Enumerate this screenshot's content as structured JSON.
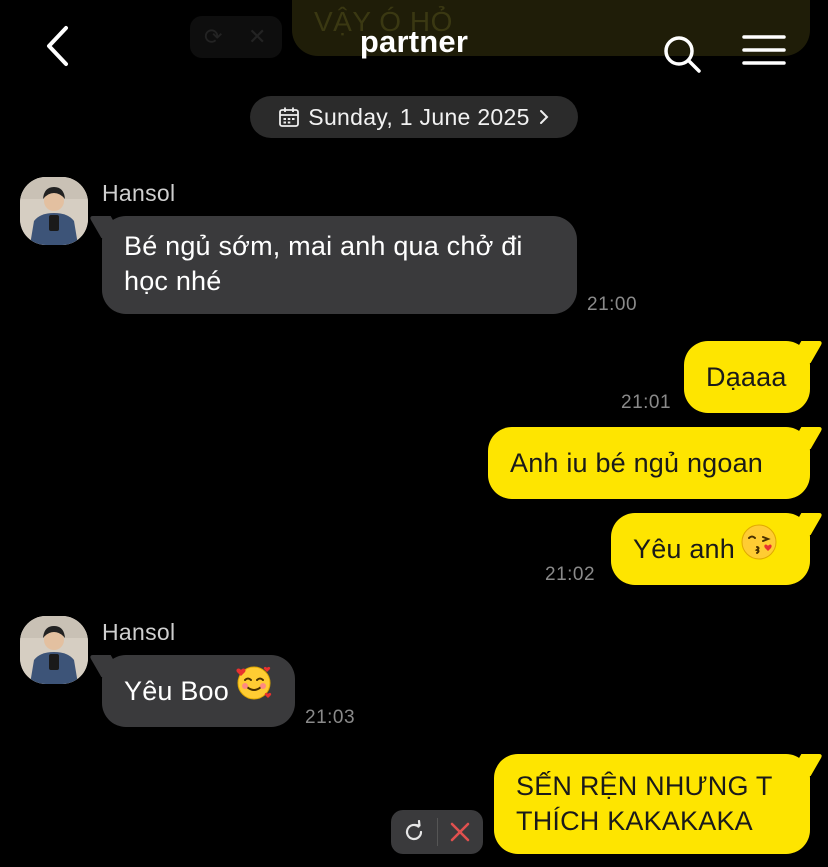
{
  "header": {
    "title": "partner",
    "back_icon": "chevron-left-icon",
    "search_icon": "search-icon",
    "menu_icon": "hamburger-menu-icon"
  },
  "background_preview": {
    "text": "VẬY Ó HỎ"
  },
  "date_divider": {
    "label": "Sunday, 1 June 2025",
    "icon": "calendar-icon"
  },
  "messages": [
    {
      "id": "m1",
      "direction": "incoming",
      "sender": "Hansol",
      "text": "Bé ngủ sớm, mai anh qua chở đi học nhé",
      "time": "21:00"
    },
    {
      "id": "m2",
      "direction": "outgoing",
      "text": "Dạaaa",
      "time": "21:01"
    },
    {
      "id": "m3",
      "direction": "outgoing",
      "text": "Anh iu bé ngủ ngoan",
      "time": ""
    },
    {
      "id": "m4",
      "direction": "outgoing",
      "text": "Yêu anh",
      "emoji": "kissing-face-emoji",
      "time": "21:02"
    },
    {
      "id": "m5",
      "direction": "incoming",
      "sender": "Hansol",
      "text": "Yêu Boo",
      "emoji": "smiling-face-with-hearts-emoji",
      "time": "21:03"
    },
    {
      "id": "m6",
      "direction": "outgoing",
      "text": "SẾN RỆN NHƯNG T THÍCH KAKAKAKA",
      "time": "",
      "status": "failed"
    }
  ],
  "failed_actions": {
    "retry_icon": "retry-icon",
    "delete_icon": "delete-x-icon",
    "delete_color": "#e0504f"
  },
  "colors": {
    "background": "#000000",
    "incoming_bubble": "#3a3a3c",
    "outgoing_bubble": "#fee500",
    "timestamp": "#8a8a8a"
  }
}
